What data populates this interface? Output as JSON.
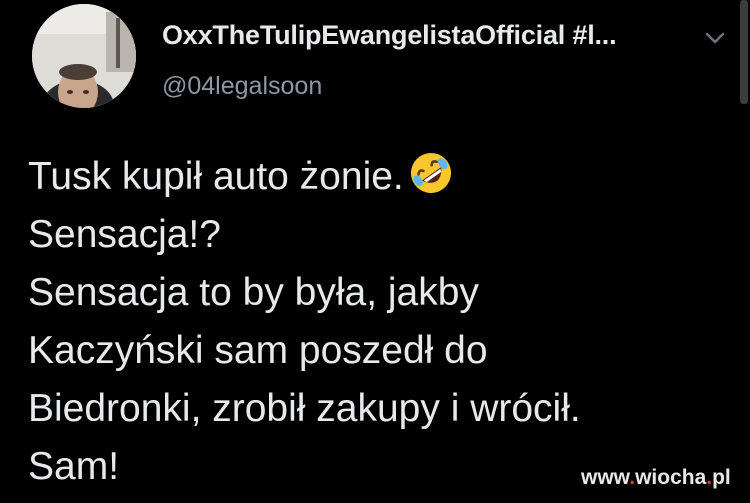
{
  "tweet": {
    "display_name": "OxxTheTulipEwangelistaOfficial #l...",
    "handle": "@04legalsoon",
    "text_lines": [
      "Tusk kupił auto żonie.",
      "Sensacja!?",
      "Sensacja to by była, jakby",
      "Kaczyński sam poszedł do",
      "Biedronki, zrobił zakupy i wrócił.",
      "Sam!"
    ],
    "emoji": "rolling-on-the-floor-laughing"
  },
  "watermark": {
    "prefix": "www",
    "dot": ".",
    "middle": "wiocha",
    "suffix": "pl"
  },
  "colors": {
    "background": "#000000",
    "text": "#e7e9ea",
    "handle": "#8b98a5",
    "watermark_dot": "#ff2d2d"
  }
}
